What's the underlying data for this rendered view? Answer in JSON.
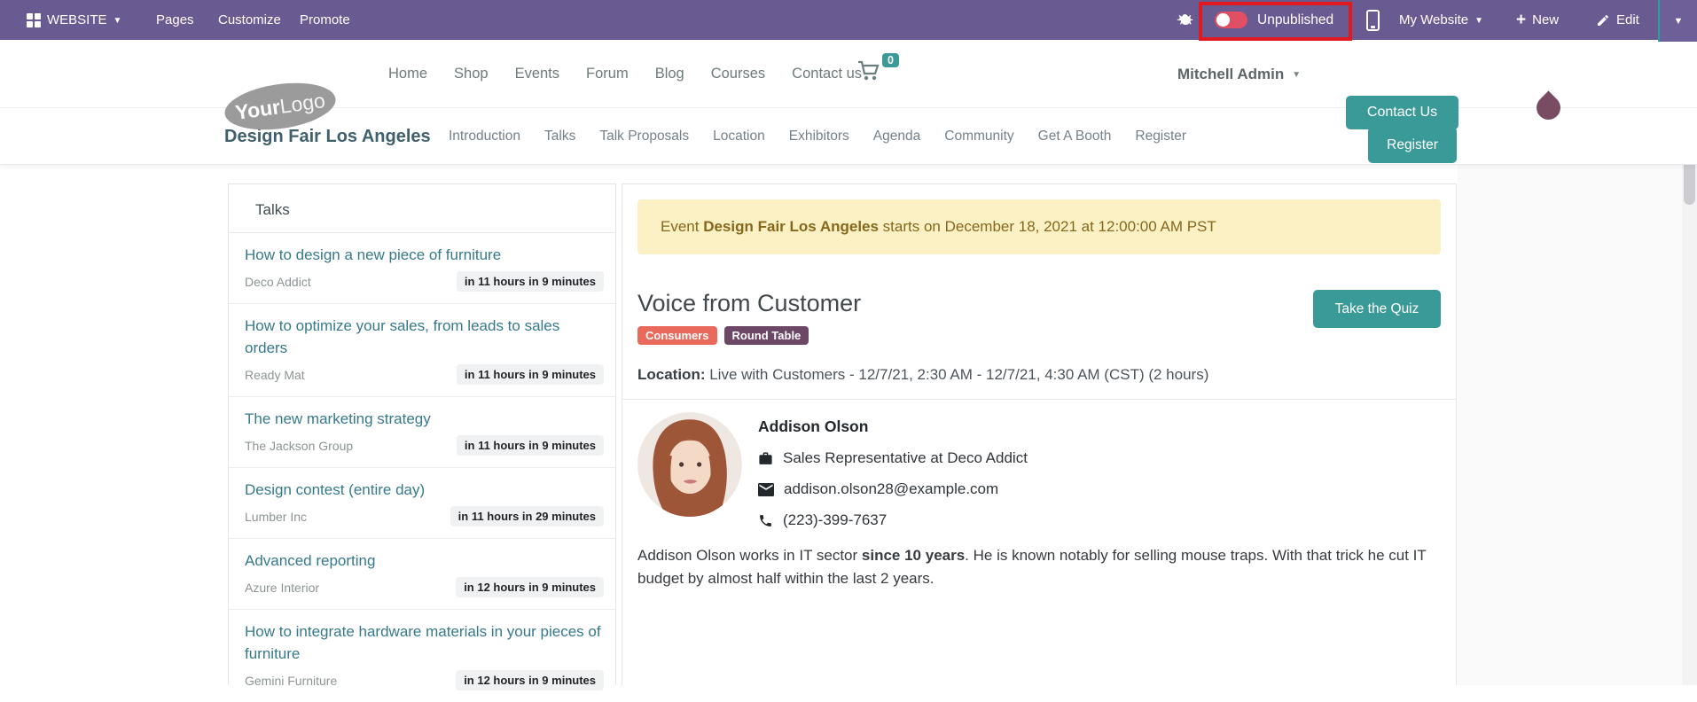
{
  "admin_bar": {
    "website_label": "WEBSITE",
    "pages_label": "Pages",
    "customize_label": "Customize",
    "promote_label": "Promote",
    "publish_toggle": {
      "state": "off",
      "label": "Unpublished"
    },
    "website_switcher": "My Website",
    "new_label": "New",
    "edit_label": "Edit"
  },
  "site_nav": {
    "logo": {
      "bold": "Your",
      "light": "Logo"
    },
    "menu": {
      "home": "Home",
      "shop": "Shop",
      "events": "Events",
      "forum": "Forum",
      "blog": "Blog",
      "courses": "Courses",
      "contact": "Contact us"
    },
    "cart_count": "0",
    "user_name": "Mitchell Admin",
    "contact_us_button": "Contact Us"
  },
  "event_nav": {
    "title": "Design Fair Los Angeles",
    "items": {
      "introduction": "Introduction",
      "talks": "Talks",
      "talk_proposals": "Talk Proposals",
      "location": "Location",
      "exhibitors": "Exhibitors",
      "agenda": "Agenda",
      "community": "Community",
      "get_a_booth": "Get A Booth",
      "register": "Register"
    },
    "register_button": "Register"
  },
  "sidebar": {
    "title": "Talks",
    "talks": [
      {
        "title": "How to design a new piece of furniture",
        "company": "Deco Addict",
        "time": "in 11 hours in 9 minutes"
      },
      {
        "title": "How to optimize your sales, from leads to sales orders",
        "company": "Ready Mat",
        "time": "in 11 hours in 9 minutes"
      },
      {
        "title": "The new marketing strategy",
        "company": "The Jackson Group",
        "time": "in 11 hours in 9 minutes"
      },
      {
        "title": "Design contest (entire day)",
        "company": "Lumber Inc",
        "time": "in 11 hours in 29 minutes"
      },
      {
        "title": "Advanced reporting",
        "company": "Azure Interior",
        "time": "in 12 hours in 9 minutes"
      },
      {
        "title": "How to integrate hardware materials in your pieces of furniture",
        "company": "Gemini Furniture",
        "time": "in 12 hours in 9 minutes"
      }
    ]
  },
  "main": {
    "alert": {
      "prefix": "Event ",
      "event_name": "Design Fair Los Angeles",
      "suffix": " starts on December 18, 2021 at 12:00:00 AM PST"
    },
    "talk_title": "Voice from Customer",
    "tags": [
      {
        "label": "Consumers",
        "color": "#e9695c"
      },
      {
        "label": "Round Table",
        "color": "#6d4766"
      }
    ],
    "quiz_button": "Take the Quiz",
    "location_label": "Location:",
    "location_value": " Live with Customers - 12/7/21, 2:30 AM - 12/7/21, 4:30 AM (CST) (2 hours)",
    "speaker": {
      "name": "Addison Olson",
      "role": "Sales Representative at Deco Addict",
      "email": "addison.olson28@example.com",
      "phone": "(223)-399-7637",
      "bio": {
        "before": "Addison Olson works in IT sector ",
        "bold": "since 10 years",
        "after": ". He is known notably for selling mouse traps. With that trick he cut IT budget by almost half within the last 2 years."
      }
    }
  },
  "colors": {
    "admin_bar_purple": "#6a5a92",
    "accent_teal": "#3a9a97",
    "toggle_red": "#e04f63",
    "highlight_red": "#e2181f",
    "alert_bg": "#fcf0c5",
    "alert_text": "#85681c",
    "tag_consumers": "#e9695c",
    "tag_round_table": "#6d4766",
    "avatar_plum": "#7a4c63"
  }
}
